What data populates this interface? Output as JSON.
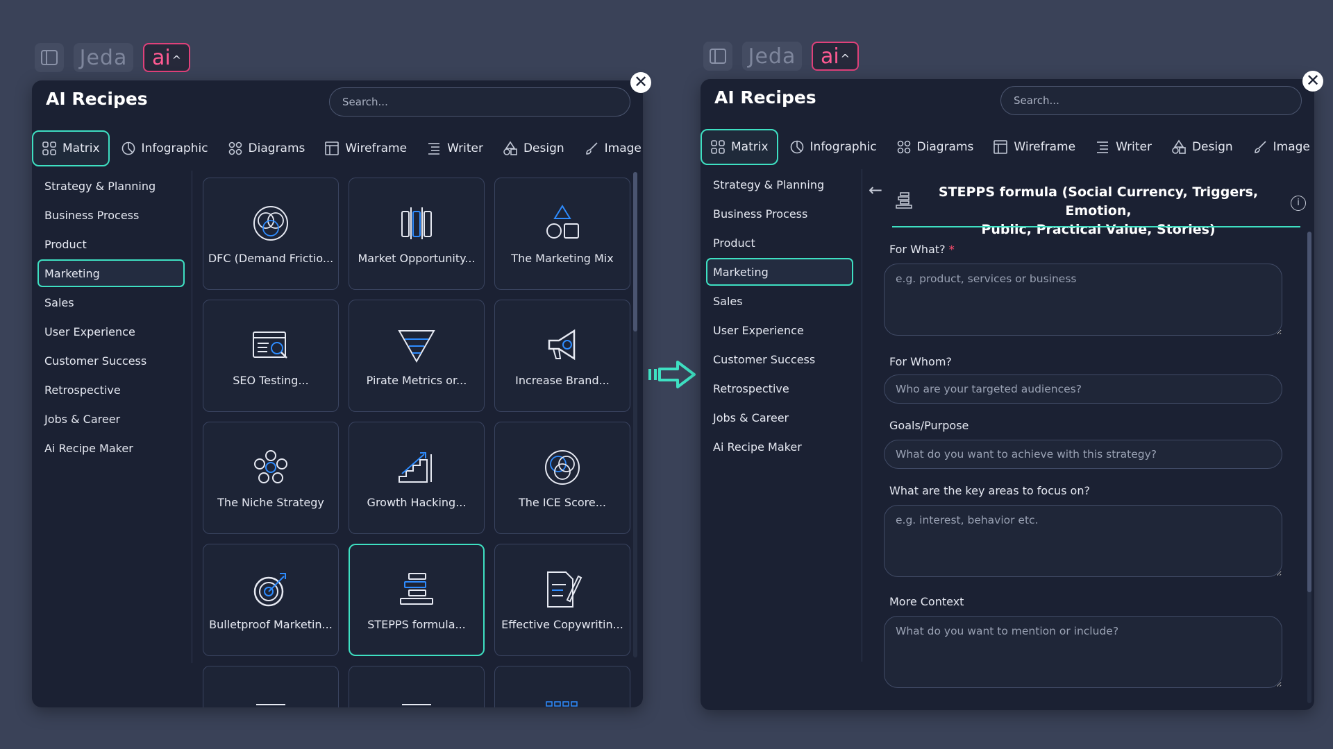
{
  "app": {
    "brand": "Jeda",
    "ai_label": "ai",
    "chevron": "^"
  },
  "panel": {
    "title": "AI Recipes",
    "search_placeholder": "Search...",
    "close_glyph": "✕"
  },
  "tabs": [
    {
      "label": "Matrix",
      "icon": "grid-icon"
    },
    {
      "label": "Infographic",
      "icon": "pie-chart-icon"
    },
    {
      "label": "Diagrams",
      "icon": "shapes-icon"
    },
    {
      "label": "Wireframe",
      "icon": "wireframe-icon"
    },
    {
      "label": "Writer",
      "icon": "list-icon"
    },
    {
      "label": "Design",
      "icon": "design-icon"
    },
    {
      "label": "Image",
      "icon": "brush-icon"
    }
  ],
  "categories": [
    "Strategy & Planning",
    "Business Process",
    "Product",
    "Marketing",
    "Sales",
    "User Experience",
    "Customer Success",
    "Retrospective",
    "Jobs & Career",
    "Ai Recipe Maker"
  ],
  "active_category": "Marketing",
  "cards": [
    {
      "label": "DFC (Demand Frictio...",
      "icon": "venn-icon"
    },
    {
      "label": "Market Opportunity...",
      "icon": "columns-icon"
    },
    {
      "label": "The Marketing Mix",
      "icon": "shapes-mix-icon"
    },
    {
      "label": "SEO Testing...",
      "icon": "seo-browser-icon"
    },
    {
      "label": "Pirate Metrics or...",
      "icon": "funnel-icon"
    },
    {
      "label": "Increase Brand...",
      "icon": "megaphone-icon"
    },
    {
      "label": "The Niche Strategy",
      "icon": "flower-icon"
    },
    {
      "label": "Growth Hacking...",
      "icon": "growth-stairs-icon"
    },
    {
      "label": "The ICE Score...",
      "icon": "venn-three-icon"
    },
    {
      "label": "Bulletproof Marketin...",
      "icon": "target-icon"
    },
    {
      "label": "STEPPS formula...",
      "icon": "stack-icon"
    },
    {
      "label": "Effective Copywritin...",
      "icon": "document-pen-icon"
    }
  ],
  "form": {
    "back_glyph": "←",
    "info_glyph": "i",
    "title_line1": "STEPPS formula (Social Currency, Triggers, Emotion,",
    "title_line2": "Public, Practical Value, Stories)",
    "fields": [
      {
        "label": "For What?",
        "required_mark": "*",
        "placeholder": "e.g. product, services or business"
      },
      {
        "label": "For Whom?",
        "placeholder": "Who are your targeted audiences?"
      },
      {
        "label": "Goals/Purpose",
        "placeholder": "What do you want to achieve with this strategy?"
      },
      {
        "label": "What are the key areas to focus on?",
        "placeholder": "e.g. interest, behavior etc."
      },
      {
        "label": "More Context",
        "placeholder": "What do you want to mention or include?"
      }
    ]
  },
  "colors": {
    "accent": "#3ee0c2",
    "ai_pink": "#e0417a",
    "panel_bg": "#1b2133",
    "page_bg": "#3a4258"
  }
}
